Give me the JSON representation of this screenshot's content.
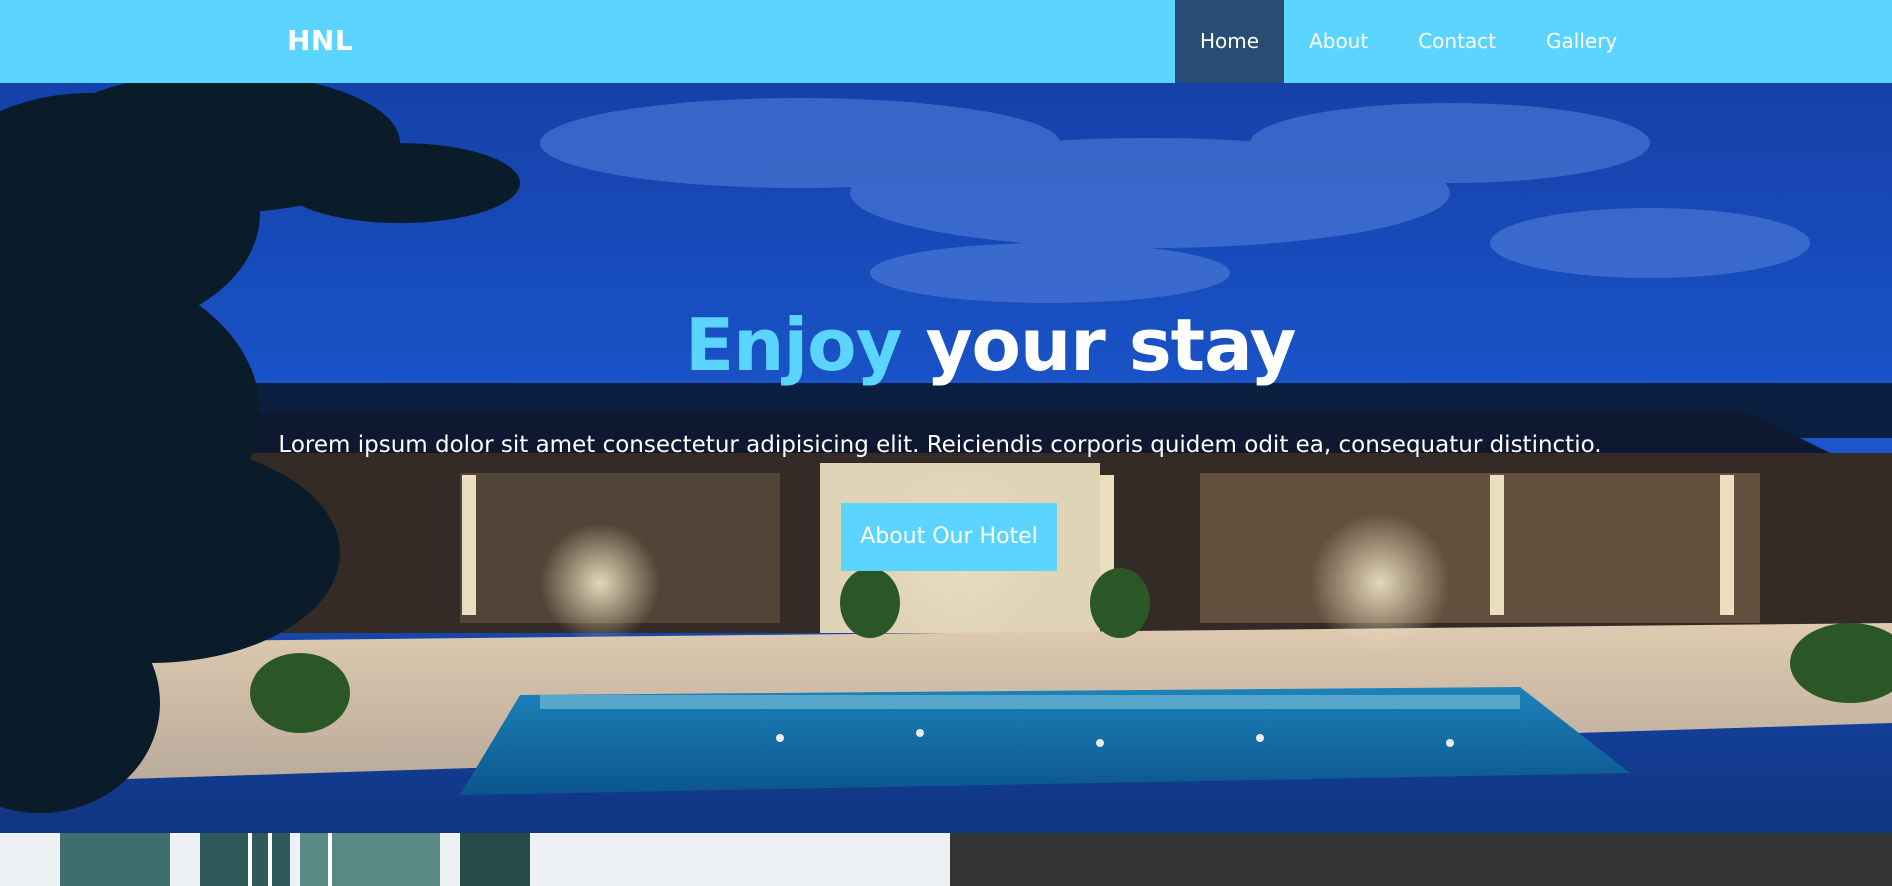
{
  "navbar": {
    "brand": "HNL",
    "links": [
      {
        "label": "Home",
        "active": true
      },
      {
        "label": "About",
        "active": false
      },
      {
        "label": "Contact",
        "active": false
      },
      {
        "label": "Gallery",
        "active": false
      }
    ]
  },
  "hero": {
    "title_accent": "Enjoy",
    "title_rest": " your stay",
    "subtitle": "Lorem ipsum dolor sit amet consectetur adipisicing elit. Reiciendis corporis quidem odit ea, consequatur distinctio.",
    "button_label": "About Our Hotel"
  },
  "colors": {
    "accent": "#5bd5ff",
    "nav_active": "#274d74",
    "dark_panel": "#343434"
  }
}
